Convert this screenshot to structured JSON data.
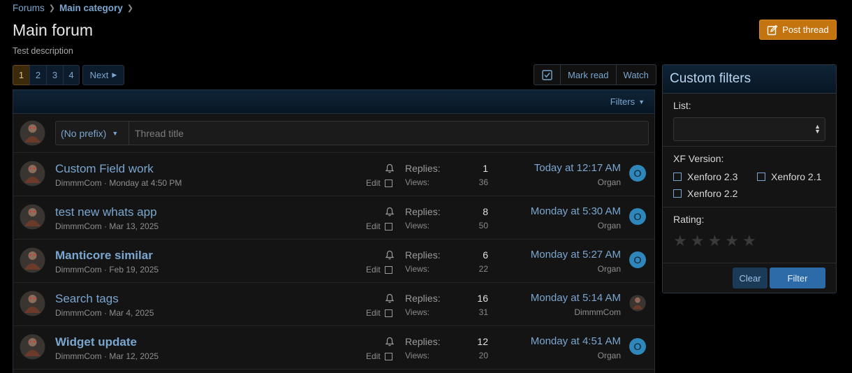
{
  "breadcrumb": {
    "forums": "Forums",
    "category": "Main category"
  },
  "page": {
    "title": "Main forum",
    "description": "Test description"
  },
  "post_thread_label": "Post thread",
  "pagination": {
    "pages": [
      "1",
      "2",
      "3",
      "4"
    ],
    "current": "1",
    "next_label": "Next"
  },
  "actions": {
    "mark_read": "Mark read",
    "watch": "Watch"
  },
  "threadlist": {
    "filters_label": "Filters",
    "quick_thread": {
      "prefix": "(No prefix)",
      "placeholder": "Thread title"
    },
    "labels": {
      "replies": "Replies:",
      "views": "Views:",
      "edit": "Edit"
    },
    "threads": [
      {
        "title": "Custom Field work",
        "bold": false,
        "author": "DimmmCom",
        "date": "Monday at 4:50 PM",
        "replies": "1",
        "views": "36",
        "last_date": "Today at 12:17 AM",
        "last_user": "Organ",
        "last_avatar": "O"
      },
      {
        "title": "test new whats app",
        "bold": false,
        "author": "DimmmCom",
        "date": "Mar 13, 2025",
        "replies": "8",
        "views": "50",
        "last_date": "Monday at 5:30 AM",
        "last_user": "Organ",
        "last_avatar": "O"
      },
      {
        "title": "Manticore similar",
        "bold": true,
        "author": "DimmmCom",
        "date": "Feb 19, 2025",
        "replies": "6",
        "views": "22",
        "last_date": "Monday at 5:27 AM",
        "last_user": "Organ",
        "last_avatar": "O"
      },
      {
        "title": "Search tags",
        "bold": false,
        "author": "DimmmCom",
        "date": "Mar 4, 2025",
        "replies": "16",
        "views": "31",
        "last_date": "Monday at 5:14 AM",
        "last_user": "DimmmCom",
        "last_avatar": ""
      },
      {
        "title": "Widget update",
        "bold": true,
        "author": "DimmmCom",
        "date": "Mar 12, 2025",
        "replies": "12",
        "views": "20",
        "last_date": "Monday at 4:51 AM",
        "last_user": "Organ",
        "last_avatar": "O"
      }
    ]
  },
  "custom_filters": {
    "title": "Custom filters",
    "list_label": "List:",
    "list_value": "",
    "version_label": "XF Version:",
    "versions": [
      "Xenforo 2.3",
      "Xenforo 2.1",
      "Xenforo 2.2"
    ],
    "rating_label": "Rating:",
    "rating_value": 0,
    "rating_max": 5,
    "clear_label": "Clear",
    "filter_label": "Filter"
  },
  "colors": {
    "accent": "#7aa6cf",
    "post_button": "#c4740f",
    "filter_button": "#2c6aa8",
    "badge": "#2e86ba"
  }
}
